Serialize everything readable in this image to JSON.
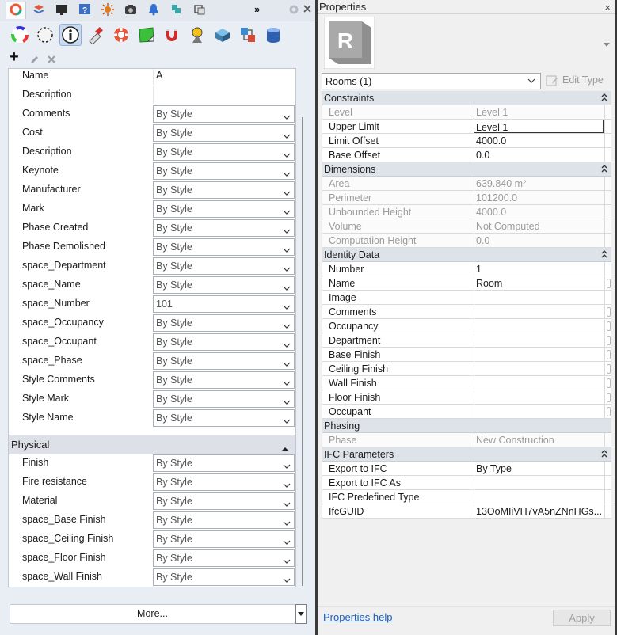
{
  "left": {
    "tabs": [
      {
        "icon": "color-wheel-icon"
      },
      {
        "icon": "layers-icon"
      },
      {
        "icon": "display-icon"
      },
      {
        "icon": "help-page-icon"
      },
      {
        "icon": "sun-icon"
      },
      {
        "icon": "camera-icon"
      },
      {
        "icon": "bell-icon"
      },
      {
        "icon": "plugin-icon"
      },
      {
        "icon": "object-icon"
      }
    ],
    "tabs_overflow": "»",
    "toolbar_icons": [
      "color-icon",
      "material-icon",
      "object-properties-icon",
      "pencil-tool-icon",
      "lifebuoy-icon",
      "green-patch-icon",
      "magnet-icon",
      "light-icon",
      "box-icon",
      "network-icon",
      "database-icon"
    ],
    "add_label": "+",
    "properties_top": [
      {
        "name": "Name",
        "value": "A",
        "type": "text"
      },
      {
        "name": "Description",
        "value": "",
        "type": "text"
      },
      {
        "name": "Comments",
        "value": "By Style",
        "type": "combo"
      },
      {
        "name": "Cost",
        "value": "By Style",
        "type": "combo"
      },
      {
        "name": "Description",
        "value": "By Style",
        "type": "combo"
      },
      {
        "name": "Keynote",
        "value": "By Style",
        "type": "combo"
      },
      {
        "name": "Manufacturer",
        "value": "By Style",
        "type": "combo"
      },
      {
        "name": "Mark",
        "value": "By Style",
        "type": "combo"
      },
      {
        "name": "Phase Created",
        "value": "By Style",
        "type": "combo"
      },
      {
        "name": "Phase Demolished",
        "value": "By Style",
        "type": "combo"
      },
      {
        "name": "space_Department",
        "value": "By Style",
        "type": "combo"
      },
      {
        "name": "space_Name",
        "value": "By Style",
        "type": "combo"
      },
      {
        "name": "space_Number",
        "value": "101",
        "type": "combo"
      },
      {
        "name": "space_Occupancy",
        "value": "By Style",
        "type": "combo"
      },
      {
        "name": "space_Occupant",
        "value": "By Style",
        "type": "combo"
      },
      {
        "name": "space_Phase",
        "value": "By Style",
        "type": "combo"
      },
      {
        "name": "Style Comments",
        "value": "By Style",
        "type": "combo"
      },
      {
        "name": "Style Mark",
        "value": "By Style",
        "type": "combo"
      },
      {
        "name": "Style Name",
        "value": "By Style",
        "type": "combo"
      }
    ],
    "physical_header": "Physical",
    "properties_physical": [
      {
        "name": "Finish",
        "value": "By Style"
      },
      {
        "name": "Fire resistance",
        "value": "By Style"
      },
      {
        "name": "Material",
        "value": "By Style"
      },
      {
        "name": "space_Base Finish",
        "value": "By Style"
      },
      {
        "name": "space_Ceiling Finish",
        "value": "By Style"
      },
      {
        "name": "space_Floor Finish",
        "value": "By Style"
      },
      {
        "name": "space_Wall Finish",
        "value": "By Style"
      }
    ],
    "more_label": "More..."
  },
  "right": {
    "title": "Properties",
    "close": "×",
    "logo_letter": "R",
    "type_selector": "Rooms (1)",
    "edit_type": "Edit Type",
    "groups": [
      {
        "name": "Constraints",
        "rows": [
          {
            "label": "Level",
            "value": "Level 1",
            "ro": true
          },
          {
            "label": "Upper Limit",
            "value": "Level 1",
            "editing": true
          },
          {
            "label": "Limit Offset",
            "value": "4000.0"
          },
          {
            "label": "Base Offset",
            "value": "0.0"
          }
        ]
      },
      {
        "name": "Dimensions",
        "rows": [
          {
            "label": "Area",
            "value": "639.840 m²",
            "ro": true
          },
          {
            "label": "Perimeter",
            "value": "101200.0",
            "ro": true
          },
          {
            "label": "Unbounded Height",
            "value": "4000.0",
            "ro": true
          },
          {
            "label": "Volume",
            "value": "Not Computed",
            "ro": true
          },
          {
            "label": "Computation Height",
            "value": "0.0",
            "ro": true
          }
        ]
      },
      {
        "name": "Identity Data",
        "rows": [
          {
            "label": "Number",
            "value": "1"
          },
          {
            "label": "Name",
            "value": "Room",
            "side": true
          },
          {
            "label": "Image",
            "value": ""
          },
          {
            "label": "Comments",
            "value": "",
            "side": true
          },
          {
            "label": "Occupancy",
            "value": "",
            "side": true
          },
          {
            "label": "Department",
            "value": "",
            "side": true
          },
          {
            "label": "Base Finish",
            "value": "",
            "side": true
          },
          {
            "label": "Ceiling Finish",
            "value": "",
            "side": true
          },
          {
            "label": "Wall Finish",
            "value": "",
            "side": true
          },
          {
            "label": "Floor Finish",
            "value": "",
            "side": true
          },
          {
            "label": "Occupant",
            "value": "",
            "side": true
          }
        ]
      },
      {
        "name": "Phasing",
        "collapsible": false,
        "rows": [
          {
            "label": "Phase",
            "value": "New Construction",
            "ro": true
          }
        ]
      },
      {
        "name": "IFC Parameters",
        "rows": [
          {
            "label": "Export to IFC",
            "value": "By Type"
          },
          {
            "label": "Export to IFC As",
            "value": ""
          },
          {
            "label": "IFC Predefined Type",
            "value": ""
          },
          {
            "label": "IfcGUID",
            "value": "13OoMIiVH7vA5nZNnHGs..."
          }
        ]
      }
    ],
    "help_link": "Properties help",
    "apply_label": "Apply"
  }
}
